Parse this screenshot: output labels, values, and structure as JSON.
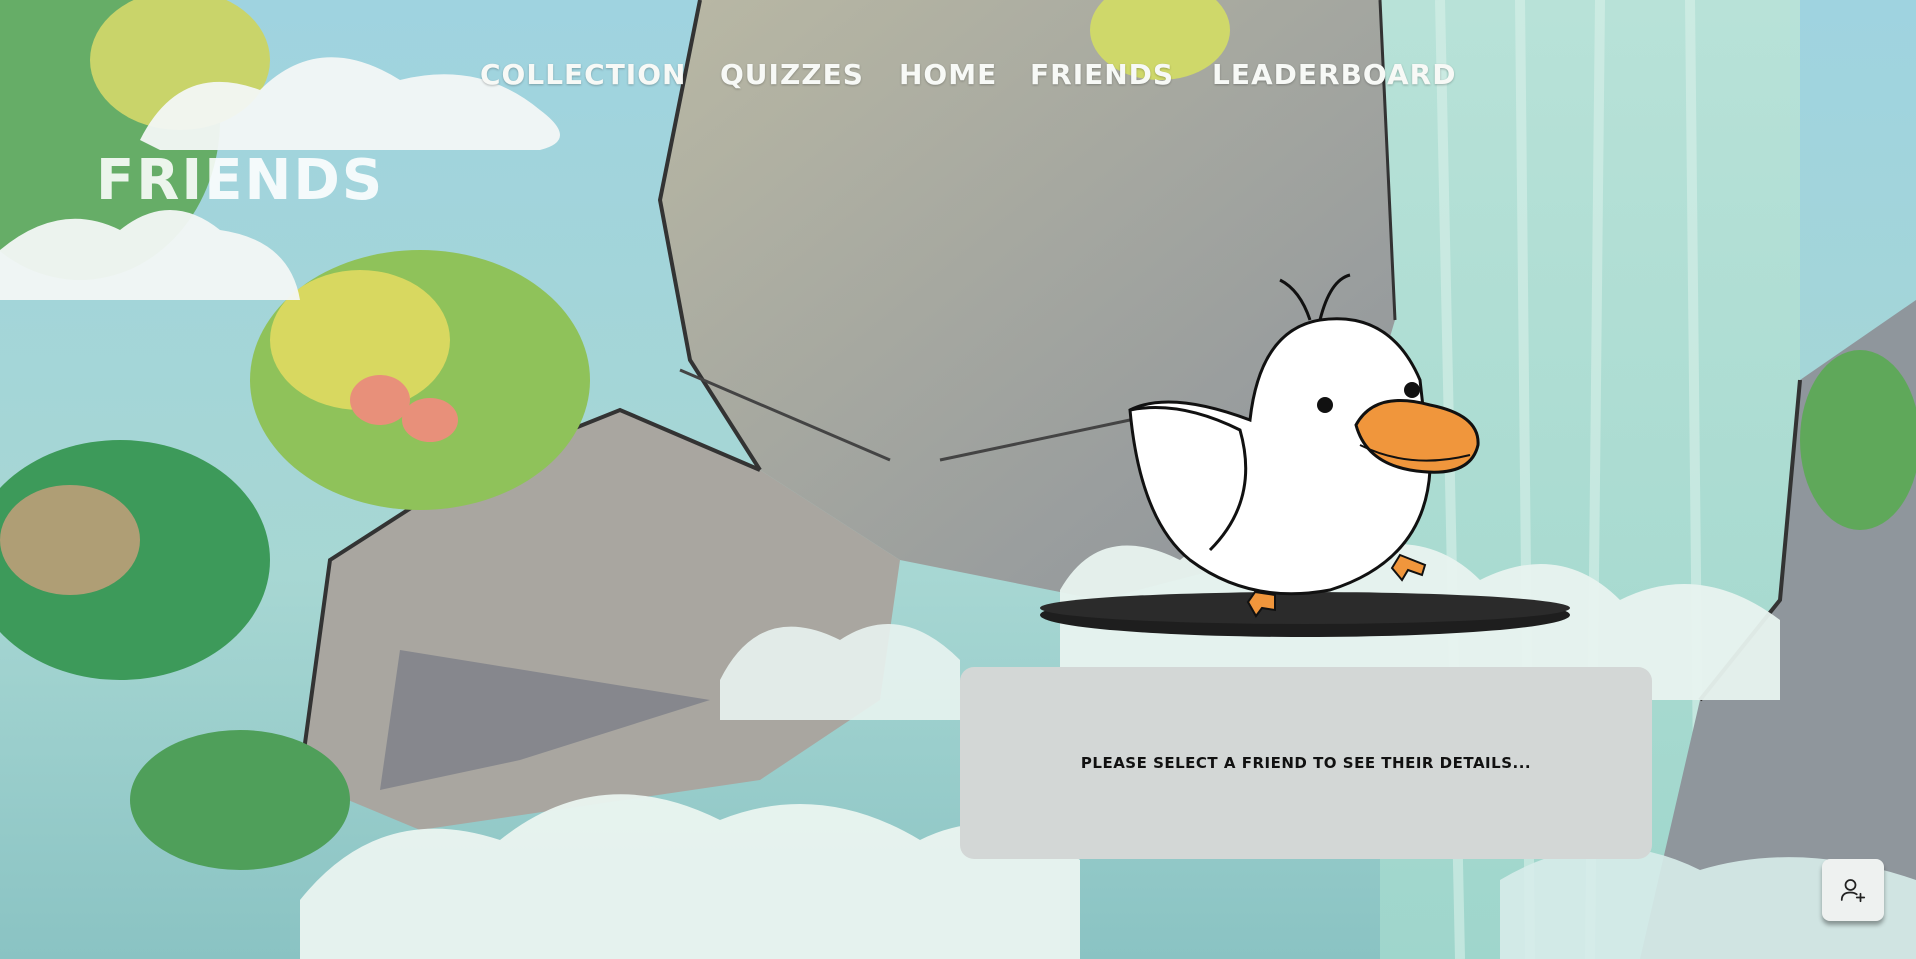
{
  "nav": {
    "items": [
      {
        "label": "Collection"
      },
      {
        "label": "Quizzes"
      },
      {
        "label": "Home"
      },
      {
        "label": "Friends"
      },
      {
        "label": "Leaderboard"
      }
    ]
  },
  "page": {
    "title": "Friends"
  },
  "details": {
    "placeholder": "Please select a friend to see their details..."
  },
  "actions": {
    "add_friend_icon": "add-user-icon"
  },
  "colors": {
    "card": "#d3d7d6",
    "duck_body": "#ffffff",
    "duck_beak": "#f0963c",
    "platform": "#222222",
    "nav_text": "#f7f9f6"
  }
}
